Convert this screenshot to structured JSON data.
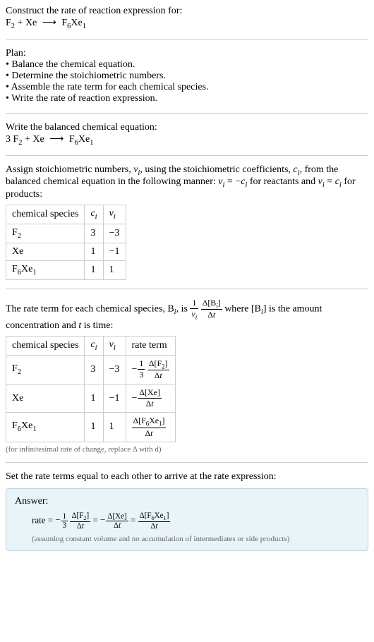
{
  "intro": {
    "title": "Construct the rate of reaction expression for:",
    "equation_left": "F",
    "equation_plus": " + Xe ",
    "equation_arrow": "⟶",
    "equation_right_pre": " F",
    "equation_right_post": "Xe"
  },
  "plan": {
    "title": "Plan:",
    "items": [
      "Balance the chemical equation.",
      "Determine the stoichiometric numbers.",
      "Assemble the rate term for each chemical species.",
      "Write the rate of reaction expression."
    ]
  },
  "balanced": {
    "title": "Write the balanced chemical equation:",
    "prefix": "3 F",
    "mid": " + Xe ",
    "arrow": "⟶",
    "suffix_pre": " F",
    "suffix_post": "Xe"
  },
  "stoich": {
    "desc_1": "Assign stoichiometric numbers, ",
    "desc_2": ", using the stoichiometric coefficients, ",
    "desc_3": ", from the balanced chemical equation in the following manner: ",
    "desc_4": " for reactants and ",
    "desc_5": " for products:",
    "nu_eq_neg_c": " = −",
    "nu_eq_c": " = ",
    "header_species": "chemical species",
    "header_c": "c",
    "header_nu": "ν",
    "rows": [
      {
        "species_pre": "F",
        "species_sub": "2",
        "species_post": "",
        "c": "3",
        "nu": "−3"
      },
      {
        "species_pre": "Xe",
        "species_sub": "",
        "species_post": "",
        "c": "1",
        "nu": "−1"
      },
      {
        "species_pre": "F",
        "species_sub": "6",
        "species_post": "Xe",
        "species_sub2": "1",
        "c": "1",
        "nu": "1"
      }
    ]
  },
  "rateterm": {
    "desc_1": "The rate term for each chemical species, B",
    "desc_2": ", is ",
    "desc_3": " where [B",
    "desc_4": "] is the amount concentration and ",
    "desc_5": " is time:",
    "t_var": "t",
    "header_species": "chemical species",
    "header_c": "c",
    "header_nu": "ν",
    "header_rate": "rate term",
    "rows": [
      {
        "c": "3",
        "nu": "−3"
      },
      {
        "c": "1",
        "nu": "−1"
      },
      {
        "c": "1",
        "nu": "1"
      }
    ],
    "note": "(for infinitesimal rate of change, replace Δ with d)"
  },
  "final": {
    "title": "Set the rate terms equal to each other to arrive at the rate expression:",
    "answer_label": "Answer:",
    "rate_label": "rate = ",
    "eq": " = ",
    "note": "(assuming constant volume and no accumulation of intermediates or side products)"
  }
}
